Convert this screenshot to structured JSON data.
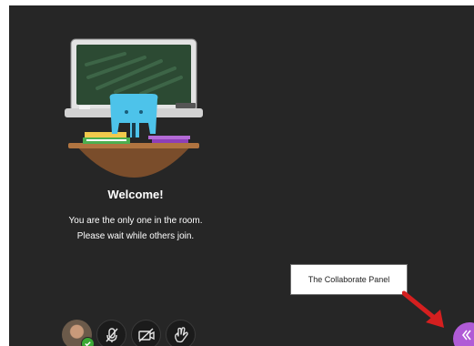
{
  "welcome": {
    "title": "Welcome!",
    "line1": "You are the only one in the room.",
    "line2": "Please wait while others join."
  },
  "controls": {
    "avatar": "user-avatar",
    "mic": "microphone-muted-icon",
    "camera": "camera-off-icon",
    "hand": "raise-hand-icon"
  },
  "callout": {
    "text": "The Collaborate Panel"
  },
  "colors": {
    "room_background": "#262626",
    "panel_accent": "#b05bd6",
    "arrow": "#d51f1f",
    "status_ok": "#3aa935"
  }
}
